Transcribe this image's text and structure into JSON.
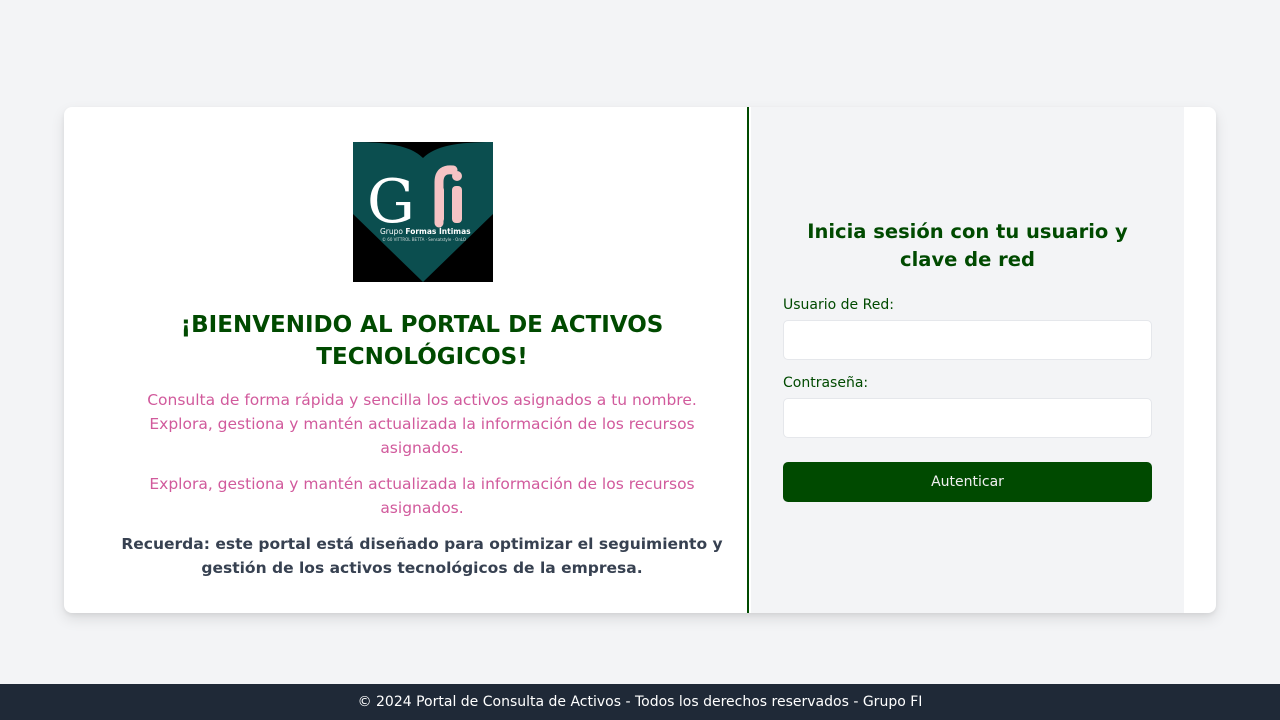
{
  "brand": {
    "logo_icon": "gfi-heart-logo",
    "logo_letters": "Gfi",
    "logo_subtitle": "Grupo Formas Íntimas",
    "logo_small": "© 60 VITTROL BETTA · Sensatstyle · OnLO",
    "colors": {
      "primary": "#004a00",
      "accent": "#d15a9c",
      "logo_teal": "#0b4e4f",
      "logo_pink": "#f5c3c4"
    }
  },
  "welcome": {
    "title": "¡BIENVENIDO AL PORTAL DE ACTIVOS TECNOLÓGICOS!",
    "description_1": "Consulta de forma rápida y sencilla los activos asignados a tu nombre. Explora, gestiona y mantén actualizada la información de los recursos asignados.",
    "description_2": "Explora, gestiona y mantén actualizada la información de los recursos asignados.",
    "reminder": "Recuerda: este portal está diseñado para optimizar el seguimiento y gestión de los activos tecnológicos de la empresa."
  },
  "login": {
    "title": "Inicia sesión con tu usuario y clave de red",
    "username_label": "Usuario de Red:",
    "username_value": "",
    "password_label": "Contraseña:",
    "password_value": "",
    "submit_label": "Autenticar"
  },
  "footer": {
    "text": "© 2024 Portal de Consulta de Activos - Todos los derechos reservados - Grupo FI"
  }
}
